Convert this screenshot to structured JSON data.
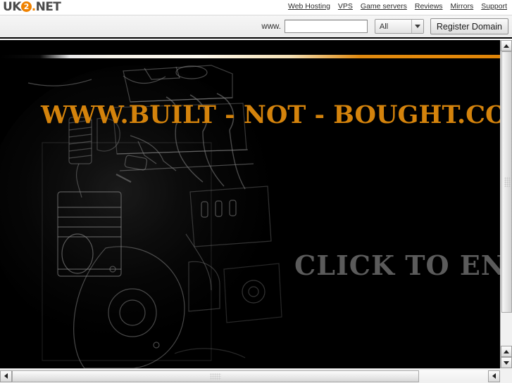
{
  "toolbar": {
    "logo": {
      "part1": "UK",
      "circle": "2",
      "dot": ".",
      "part2": "NET"
    },
    "nav": [
      {
        "label": "Web Hosting"
      },
      {
        "label": "VPS"
      },
      {
        "label": "Game servers"
      },
      {
        "label": "Reviews"
      },
      {
        "label": "Mirrors"
      },
      {
        "label": "Support"
      }
    ]
  },
  "search": {
    "prefix_label": "www.",
    "input_value": "",
    "input_placeholder": "",
    "tld_selected": "All",
    "tld_options": [
      "All"
    ],
    "register_button": "Register Domain"
  },
  "page": {
    "headline": "WWW.BUILT - NOT - BOUGHT.CO.",
    "click_to_enter": "CLICK TO ENT",
    "background_color": "#000000",
    "headline_color": "#d4830c",
    "click_color": "#5b5b5b",
    "accent_color": "#e08a10"
  },
  "scrollbars": {
    "vertical": {
      "up_arrow": "▲",
      "down_arrow": "▼"
    },
    "horizontal": {
      "left_arrow": "◀",
      "right_arrow": "▶"
    }
  }
}
